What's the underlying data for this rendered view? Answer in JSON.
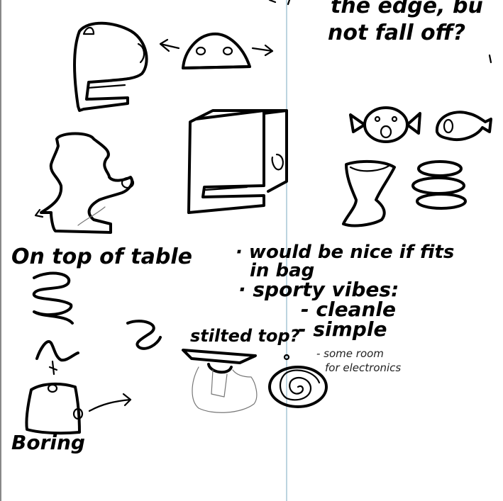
{
  "colors": {
    "paper": "#ffffff",
    "ink": "#000000",
    "pencil": "#777777",
    "page_divider": "#7aa9c0"
  },
  "notes": {
    "top_right_line1": "the edge, bu",
    "top_right_line2": "not fall off?",
    "on_top_of_table": "On top of table",
    "bullet_bag_line1": "· would be nice if fits",
    "bullet_bag_line2": "in bag",
    "bullet_sporty": "· sporty vibes:",
    "sub_clean": "- cleanle",
    "sub_simple": "- simple",
    "stilted_top": "stilted top?",
    "electronics_line1": "- some room",
    "electronics_line2": "for electronics",
    "boring": "Boring"
  },
  "icons": [
    "vase-sketch-icon",
    "dome-robot-sketch-icon",
    "box-dispenser-sketch-icon",
    "creature-sketch-icon",
    "candy-face-sketch-icon",
    "fish-sketch-icon",
    "hourglass-cup-sketch-icon",
    "stacked-discs-sketch-icon",
    "coil-sketch-icon",
    "spiral-disc-icon",
    "drum-sketch-icon",
    "stilted-tray-sketch-icon"
  ]
}
